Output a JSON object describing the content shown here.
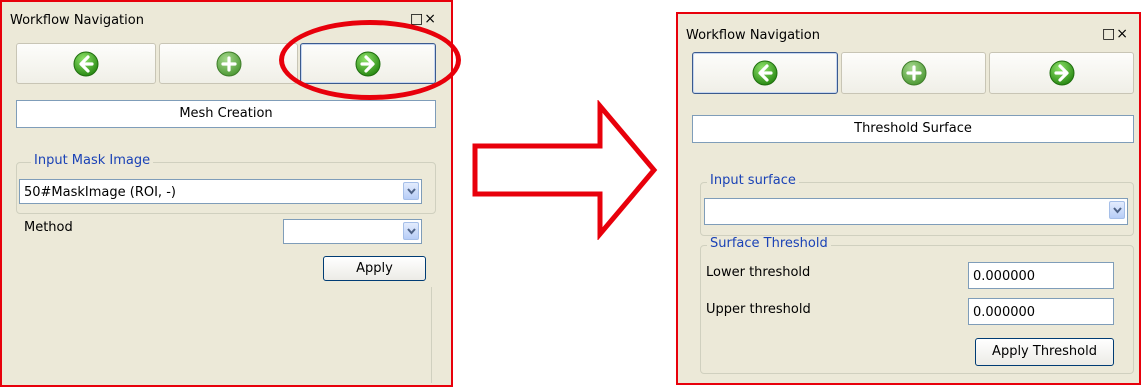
{
  "left_panel": {
    "title": "Workflow Navigation",
    "window_controls": "□×",
    "nav": {
      "back": "back",
      "add": "add",
      "forward": "forward"
    },
    "step_name": "Mesh Creation",
    "input_group": {
      "legend": "Input Mask Image",
      "selected": "50#MaskImage (ROI, -)"
    },
    "method_label": "Method",
    "method_selected": "",
    "apply_label": "Apply"
  },
  "right_panel": {
    "title": "Workflow Navigation",
    "window_controls": "□×",
    "step_name": "Threshold Surface",
    "input_group": {
      "legend": "Input surface",
      "selected": ""
    },
    "threshold_group": {
      "legend": "Surface Threshold",
      "lower_label": "Lower threshold",
      "lower_value": "0.000000",
      "upper_label": "Upper threshold",
      "upper_value": "0.000000",
      "apply_label": "Apply Threshold"
    }
  },
  "colors": {
    "annotation": "#e8000b",
    "panel_bg": "#ece9d8",
    "legend_text": "#1a42b6",
    "orb_green": "#3aa21c"
  },
  "icons": [
    "back-arrow-icon",
    "plus-icon",
    "forward-arrow-icon",
    "chevron-down-icon",
    "maximize-icon",
    "close-icon"
  ]
}
